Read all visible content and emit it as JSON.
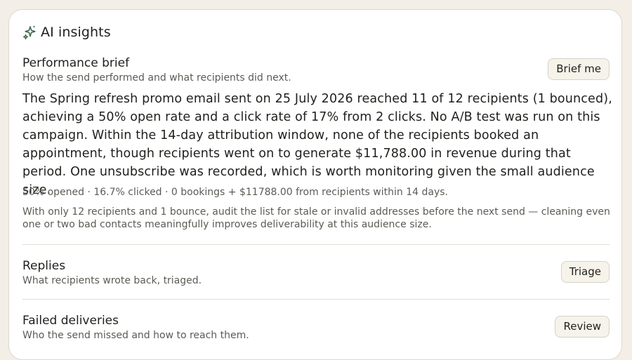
{
  "card": {
    "title": "AI insights",
    "icon": "sparkle-icon"
  },
  "performance": {
    "title": "Performance brief",
    "subtitle": "How the send performed and what recipients did next.",
    "button_label": "Brief me",
    "summary": "The Spring refresh promo email sent on 25 July 2026 reached 11 of 12 recipients (1 bounced), achieving a 50% open rate and a click rate of 17% from 2 clicks. No A/B test was run on this campaign. Within the 14-day attribution window, none of the recipients booked an appointment, though recipients went on to generate $11,788.00 in revenue during that period. One unsubscribe was recorded, which is worth monitoring given the small audience size.",
    "stats": "50% opened · 16.7% clicked · 0 bookings + $11788.00 from recipients within 14 days.",
    "advice": "With only 12 recipients and 1 bounce, audit the list for stale or invalid addresses before the next send — cleaning even one or two bad contacts meaningfully improves deliverability at this audience size."
  },
  "replies": {
    "title": "Replies",
    "subtitle": "What recipients wrote back, triaged.",
    "button_label": "Triage"
  },
  "failed": {
    "title": "Failed deliveries",
    "subtitle": "Who the send missed and how to reach them.",
    "button_label": "Review"
  },
  "colors": {
    "accent_icon": "#3f6b4f",
    "background": "#f3efe6",
    "button_bg": "#f6f3ea"
  }
}
